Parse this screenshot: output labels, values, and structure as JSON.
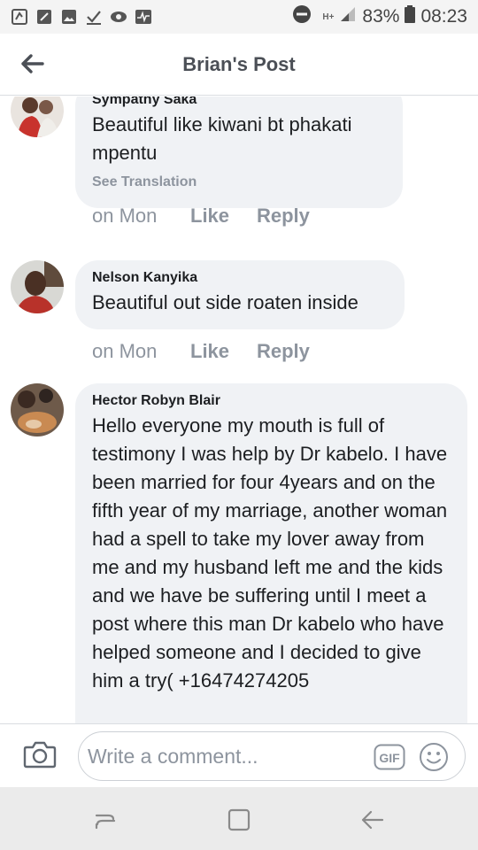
{
  "status_bar": {
    "network_label": "H+",
    "battery_percent": "83%",
    "time": "08:23",
    "icons_left": [
      "notes-icon",
      "flag-icon",
      "image-icon",
      "check-icon",
      "eye-icon",
      "pulse-icon"
    ],
    "icons_right": [
      "dnd-icon",
      "signal-icon",
      "battery-icon"
    ]
  },
  "header": {
    "title": "Brian's Post",
    "back_icon": "arrow-left-icon"
  },
  "comments": [
    {
      "author": "Sympathy Saka",
      "text": "Beautiful like kiwani  bt phakati mpentu",
      "see_translation": "See Translation",
      "time": "on Mon",
      "like": "Like",
      "reply": "Reply"
    },
    {
      "author": "Nelson Kanyika",
      "text": "Beautiful out side roaten inside",
      "time": "on Mon",
      "like": "Like",
      "reply": "Reply"
    },
    {
      "author": "Hector Robyn Blair",
      "text": "Hello everyone my mouth is full of testimony I was help by Dr kabelo. I have been married for four 4years and on the fifth year of my marriage, another woman had a spell to take my lover away from me and my husband left me and the kids and we have be suffering until I meet a post where this man Dr kabelo who have helped someone and I decided to give him a try( +16474274205"
    }
  ],
  "composer": {
    "placeholder": "Write a comment...",
    "gif_label": "GIF",
    "camera_icon": "camera-icon",
    "emoji_icon": "smiley-icon"
  },
  "navigation": {
    "buttons": [
      "recent-apps-icon",
      "home-icon",
      "back-icon"
    ]
  },
  "colors": {
    "bubble": "#f0f2f5",
    "secondary_text": "#8d949e",
    "header_text": "#4b4f56"
  }
}
